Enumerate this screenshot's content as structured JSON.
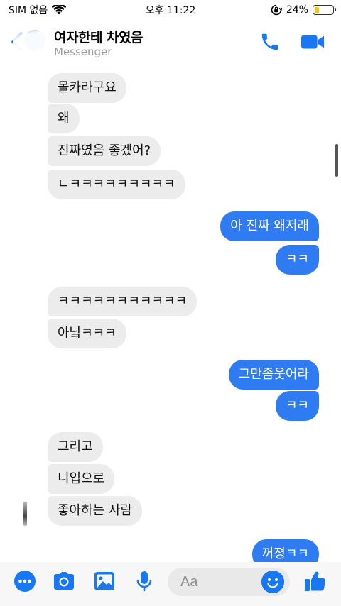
{
  "status_bar": {
    "carrier": "SIM 없음",
    "time": "오후 11:22",
    "battery_percent": "24%",
    "battery_level": 0.24,
    "battery_color": "#f2c418"
  },
  "header": {
    "title": "여자한테 차였음",
    "subtitle": "Messenger",
    "icons": [
      "chevron-left-icon",
      "phone-icon",
      "video-camera-icon"
    ],
    "accent_color": "#1877f2"
  },
  "messages": [
    {
      "side": "in",
      "text": "몰카라구요"
    },
    {
      "side": "in",
      "text": "왜"
    },
    {
      "side": "in",
      "text": "진짜였음 좋겠어?"
    },
    {
      "side": "in",
      "text": "ㄴㅋㅋㅋㅋㅋㅋㅋㅋㅋ"
    },
    {
      "side": "out",
      "text": "아 진짜 왜저래"
    },
    {
      "side": "out",
      "text": "ㅋㅋ"
    },
    {
      "side": "in",
      "text": "ㅋㅋㅋㅋㅋㅋㅋㅋㅋㅋㅋ"
    },
    {
      "side": "in",
      "text": "아닠ㅋㅋㅋ"
    },
    {
      "side": "out",
      "text": "그만좀웃어라"
    },
    {
      "side": "out",
      "text": "ㅋㅋ"
    },
    {
      "side": "in",
      "text": "그리고"
    },
    {
      "side": "in",
      "text": "니입으로"
    },
    {
      "side": "in",
      "text": "좋아하는 사람"
    },
    {
      "side": "out",
      "text": "꺼졍ㅋㅋ"
    }
  ],
  "composer": {
    "placeholder": "Aa",
    "icons": [
      "more-dots-icon",
      "camera-icon",
      "image-icon",
      "microphone-icon",
      "emoji-icon",
      "thumbs-up-icon"
    ]
  },
  "colors": {
    "outgoing_bubble": "#2f7bf2",
    "incoming_bubble": "#ececec"
  }
}
